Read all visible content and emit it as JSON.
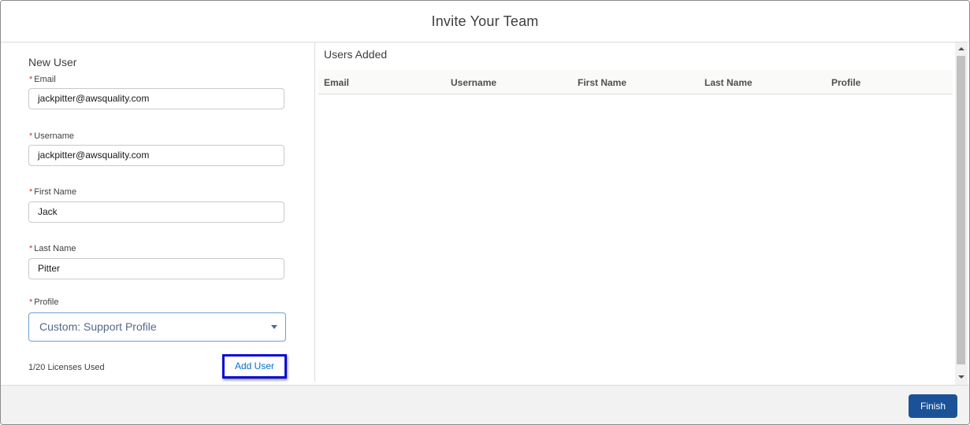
{
  "modal": {
    "title": "Invite Your Team"
  },
  "form": {
    "section_title": "New User",
    "required_marker": "*",
    "email": {
      "label": "Email",
      "value": "jackpitter@awsquality.com"
    },
    "username": {
      "label": "Username",
      "value": "jackpitter@awsquality.com"
    },
    "first_name": {
      "label": "First Name",
      "value": "Jack"
    },
    "last_name": {
      "label": "Last Name",
      "value": "Pitter"
    },
    "profile": {
      "label": "Profile",
      "value": "Custom: Support Profile"
    },
    "licenses": "1/20 Licenses Used",
    "add_user_label": "Add User"
  },
  "users_added": {
    "title": "Users Added",
    "columns": [
      "Email",
      "Username",
      "First Name",
      "Last Name",
      "Profile"
    ],
    "rows": []
  },
  "footer": {
    "finish_label": "Finish"
  },
  "colors": {
    "accent": "#1b5297",
    "focus_outline": "#0a0ad8",
    "link": "#0070d2",
    "required": "#c23934"
  }
}
